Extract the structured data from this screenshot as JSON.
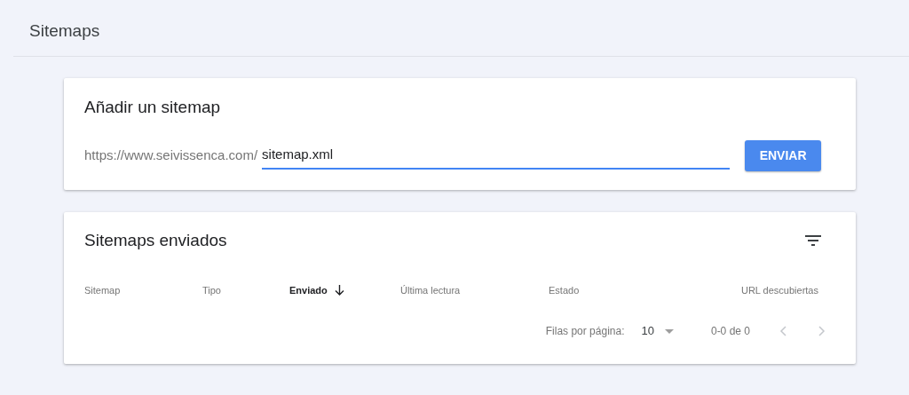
{
  "page_title": "Sitemaps",
  "add_card": {
    "title": "Añadir un sitemap",
    "prefix": "https://www.seivissenca.com/",
    "value": "sitemap.xml",
    "focused": true,
    "button": "ENVIAR"
  },
  "sent_card": {
    "title": "Sitemaps enviados",
    "columns": [
      {
        "label": "Sitemap",
        "sorted": false
      },
      {
        "label": "Tipo",
        "sorted": false
      },
      {
        "label": "Enviado",
        "sorted": true
      },
      {
        "label": "Última lectura",
        "sorted": false
      },
      {
        "label": "Estado",
        "sorted": false
      },
      {
        "label": "URL descubiertas",
        "sorted": false
      }
    ],
    "pagination": {
      "rows_label": "Filas por página:",
      "rows_value": "10",
      "range": "0-0 de 0",
      "prev_disabled": true,
      "next_disabled": true
    }
  }
}
